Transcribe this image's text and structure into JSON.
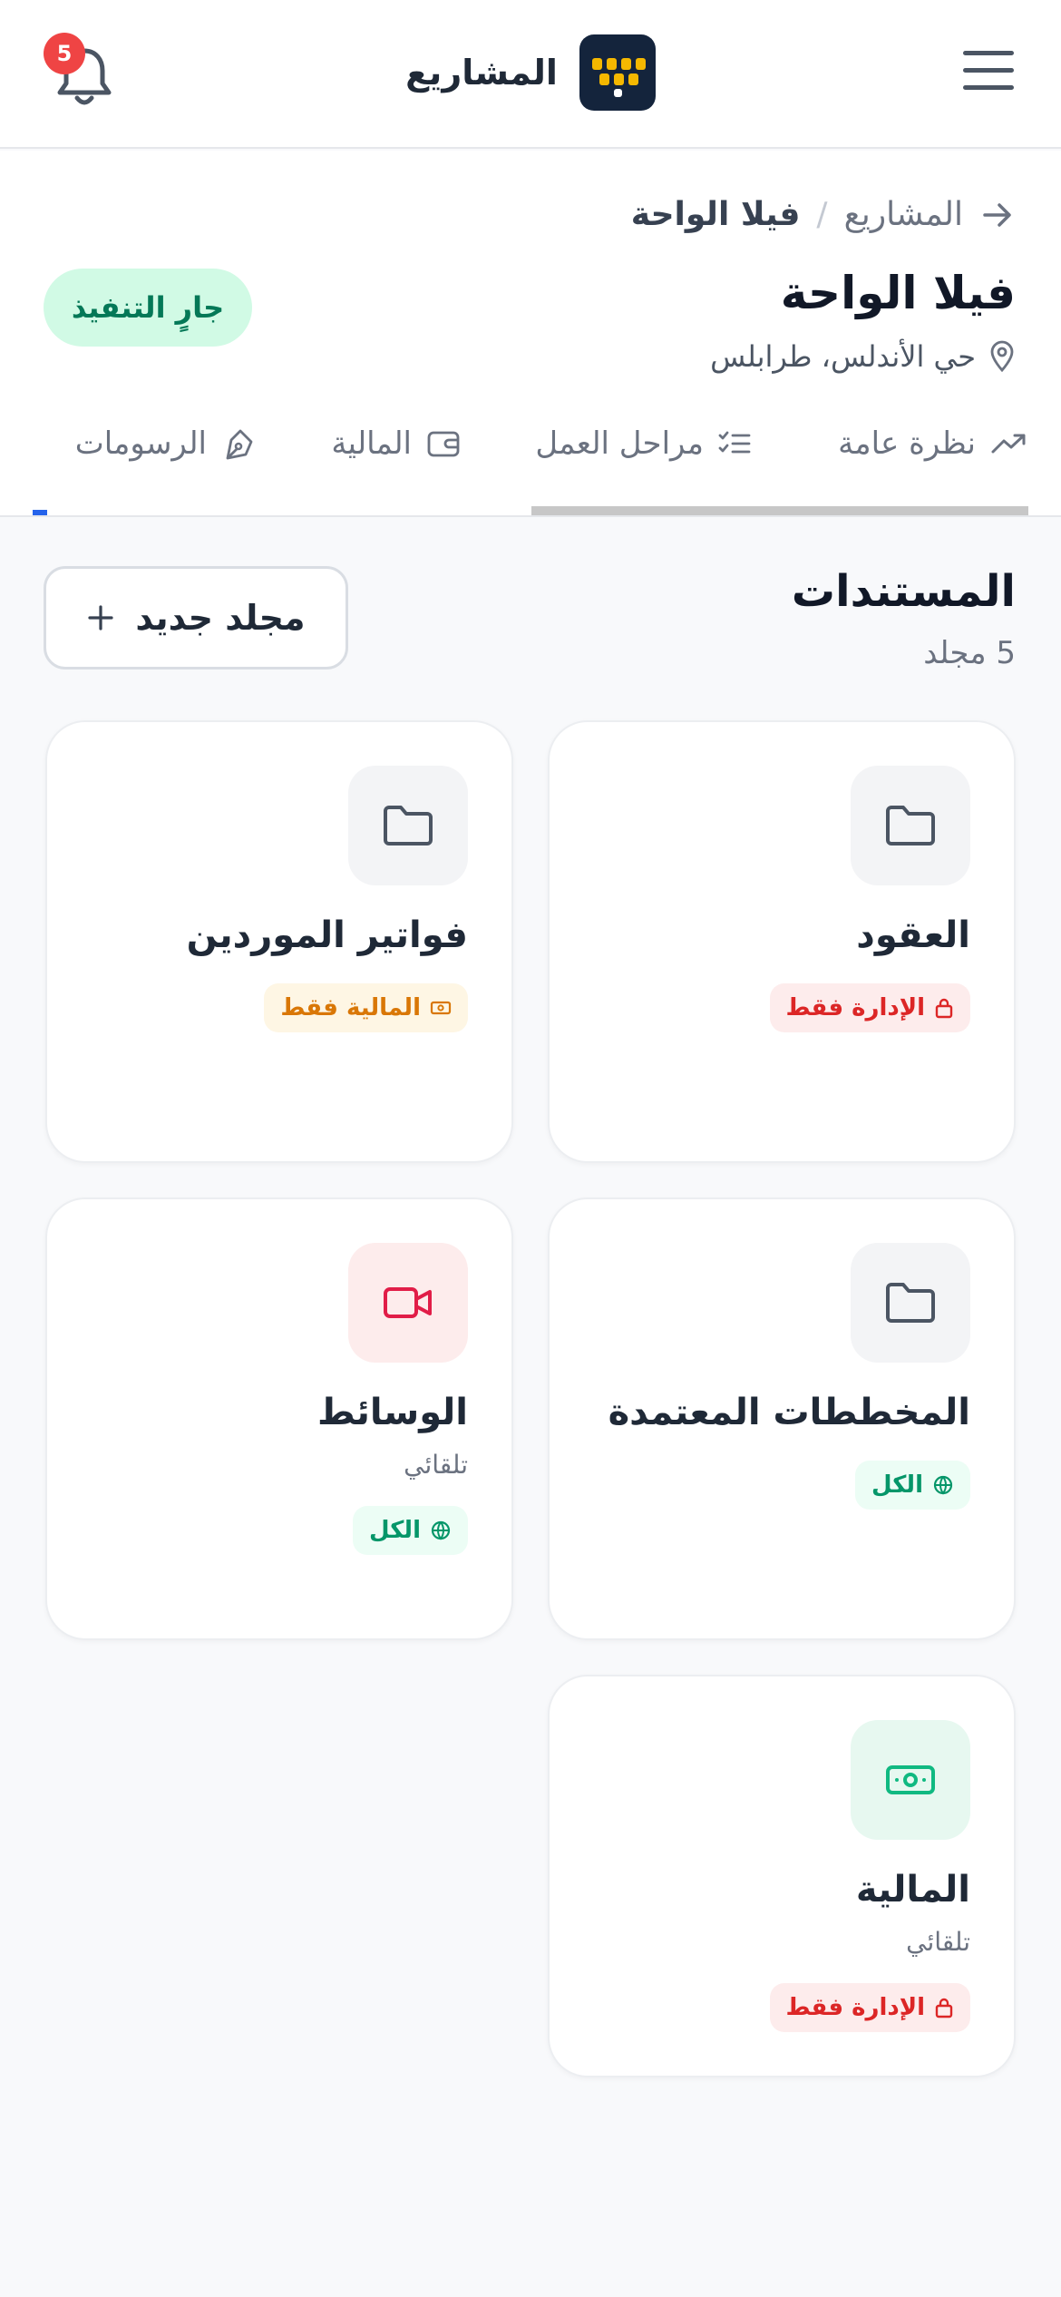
{
  "header": {
    "title": "المشاريع",
    "notifications_count": "5",
    "menu_icon": "hamburger-menu-icon",
    "bell_icon": "bell-icon"
  },
  "breadcrumb": {
    "parent": "المشاريع",
    "separator": "/",
    "current": "فيلا الواحة"
  },
  "project": {
    "title": "فيلا الواحة",
    "location": "حي الأندلس، طرابلس",
    "status": "جارٍ التنفيذ"
  },
  "tabs": [
    {
      "label": "نظرة عامة",
      "icon": "trending-up-icon"
    },
    {
      "label": "مراحل العمل",
      "icon": "checklist-icon"
    },
    {
      "label": "المالية",
      "icon": "wallet-icon"
    },
    {
      "label": "الرسومات",
      "icon": "pen-tool-icon"
    }
  ],
  "documents": {
    "title": "المستندات",
    "count": "5 مجلد",
    "new_folder": "مجلد جديد",
    "folders": [
      {
        "name": "العقود",
        "tag": "الإدارة فقط",
        "icon": "folder-icon"
      },
      {
        "name": "فواتير الموردين",
        "tag": "المالية فقط",
        "icon": "folder-icon"
      },
      {
        "name": "المخططات المعتمدة",
        "tag": "الكل",
        "icon": "folder-icon"
      },
      {
        "name": "الوسائط",
        "sub": "تلقائي",
        "tag": "الكل",
        "icon": "video-icon"
      },
      {
        "name": "المالية",
        "sub": "تلقائي",
        "tag": "الإدارة فقط",
        "icon": "banknote-icon"
      }
    ]
  },
  "colors": {
    "accent_blue": "#2563eb",
    "status_green": "#047857",
    "admin_red": "#dc2626",
    "finance_amber": "#d97706",
    "logo_navy": "#14243c",
    "logo_yellow": "#f5b800"
  }
}
